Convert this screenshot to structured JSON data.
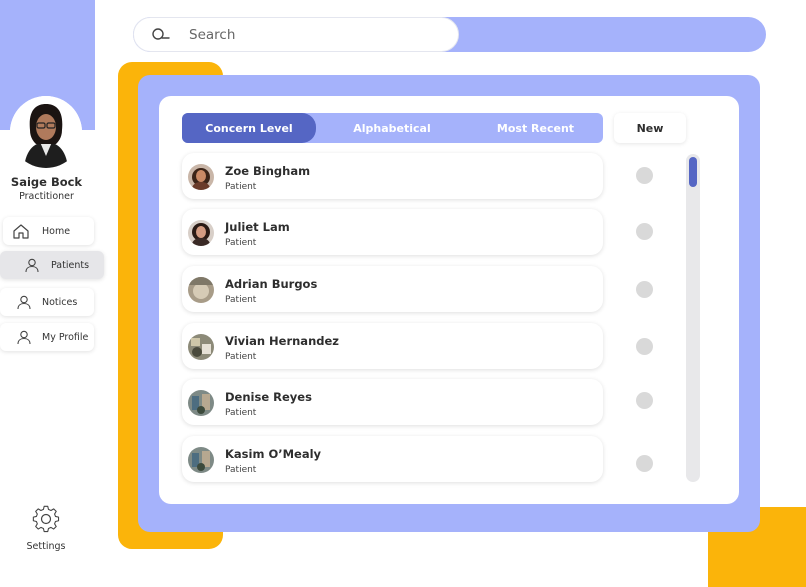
{
  "search": {
    "placeholder": "Search"
  },
  "user": {
    "name": "Saige Bock",
    "role": "Practitioner"
  },
  "nav": {
    "items": [
      {
        "label": "Home",
        "icon": "home-icon",
        "active": false
      },
      {
        "label": "Patients",
        "icon": "person-icon",
        "active": true
      },
      {
        "label": "Notices",
        "icon": "person-icon",
        "active": false
      },
      {
        "label": "My Profile",
        "icon": "person-icon",
        "active": false
      }
    ],
    "settings_label": "Settings"
  },
  "tabs": [
    {
      "label": "Concern Level",
      "active": true
    },
    {
      "label": "Alphabetical",
      "active": false
    },
    {
      "label": "Most Recent",
      "active": false
    }
  ],
  "new_label": "New",
  "patients": [
    {
      "name": "Zoe Bingham",
      "role": "Patient"
    },
    {
      "name": "Juliet Lam",
      "role": "Patient"
    },
    {
      "name": "Adrian Burgos",
      "role": "Patient"
    },
    {
      "name": "Vivian Hernandez",
      "role": "Patient"
    },
    {
      "name": "Denise Reyes",
      "role": "Patient"
    },
    {
      "name": "Kasim O’Mealy",
      "role": "Patient"
    }
  ],
  "colors": {
    "accent_light": "#a5b2fb",
    "accent_dark": "#5566c4",
    "orange": "#fbb40a",
    "status_dot": "#d9d9d9"
  }
}
